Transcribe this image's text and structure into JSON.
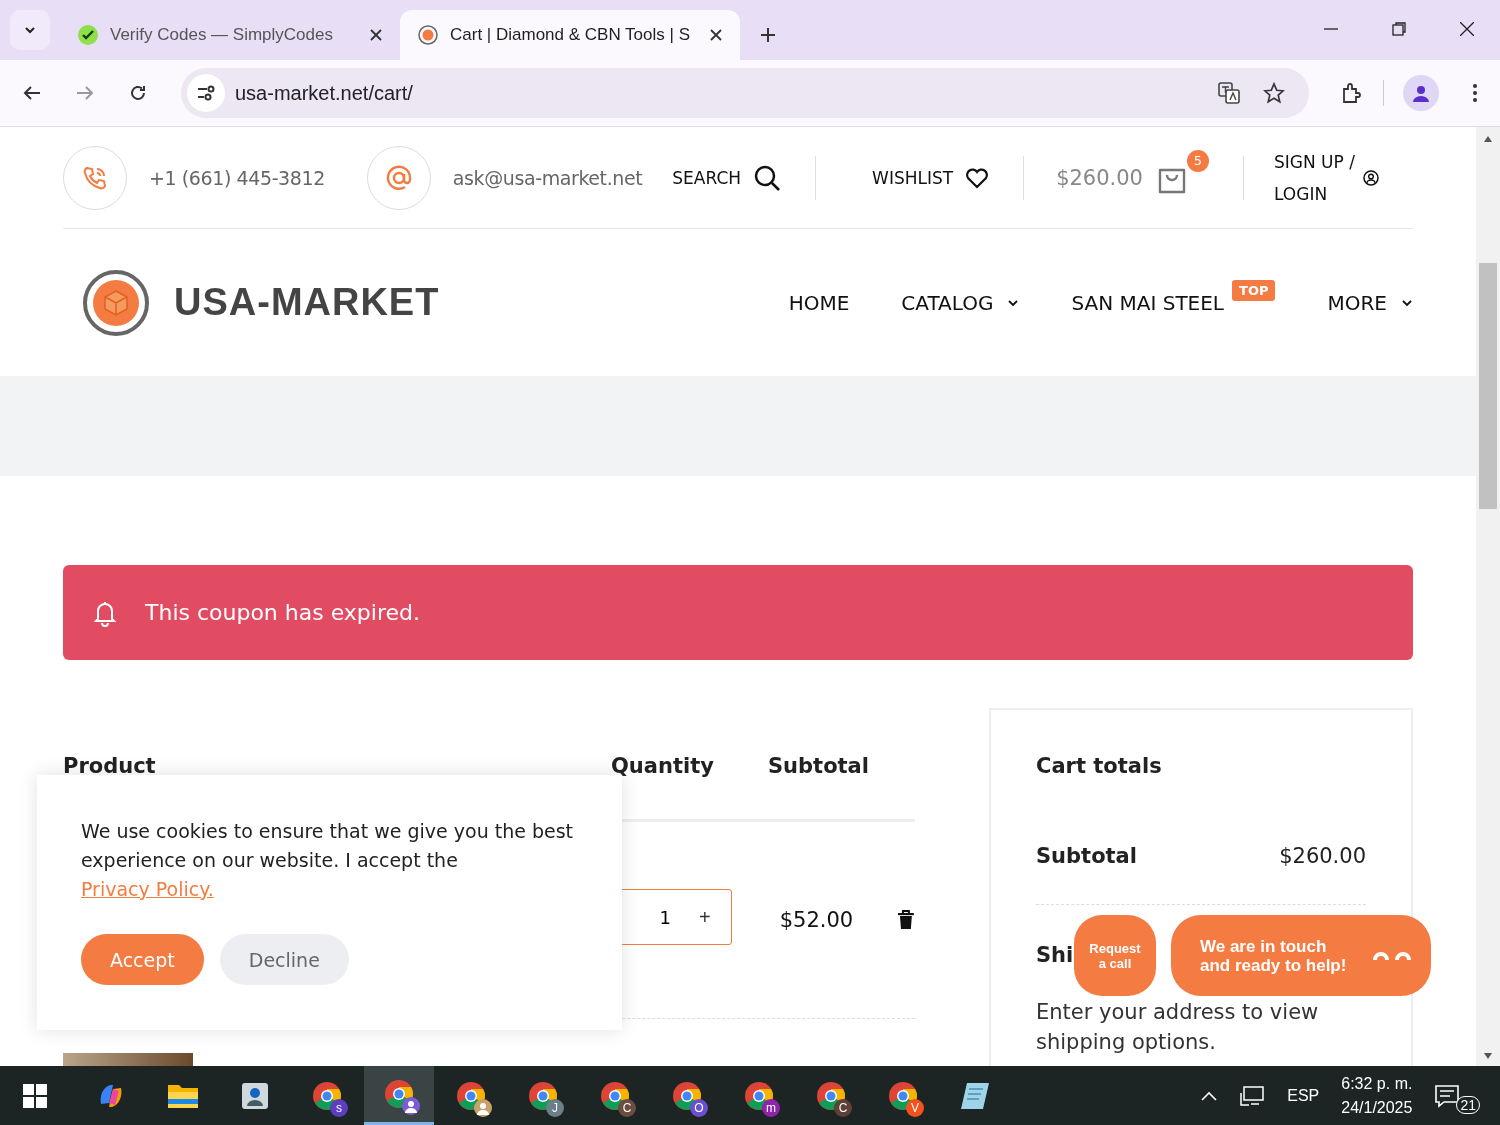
{
  "browser": {
    "tabs": [
      {
        "title": "Verify Codes — SimplyCodes",
        "selected": false
      },
      {
        "title": "Cart | Diamond & CBN Tools | S",
        "selected": true
      }
    ],
    "url": "usa-market.net/cart/"
  },
  "topbar": {
    "phone": "+1 (661) 445-3812",
    "email": "ask@usa-market.net",
    "search": "SEARCH",
    "wishlist": "WISHLIST",
    "cart_total": "$260.00",
    "cart_count": "5",
    "account": [
      "SIGN UP /",
      "LOGIN"
    ]
  },
  "header": {
    "logo": "USA-MARKET",
    "nav": [
      {
        "label": "HOME",
        "dropdown": false
      },
      {
        "label": "CATALOG",
        "dropdown": true
      },
      {
        "label": "SAN MAI STEEL",
        "dropdown": false,
        "badge": "TOP"
      },
      {
        "label": "MORE",
        "dropdown": true
      }
    ]
  },
  "notice": "This coupon has expired.",
  "cart_table": {
    "columns": [
      "Product",
      "Quantity",
      "Subtotal"
    ],
    "rows": [
      {
        "quantity": "1",
        "increment": "+",
        "subtotal": "$52.00"
      }
    ]
  },
  "cart_totals": {
    "title": "Cart totals",
    "subtotal_label": "Subtotal",
    "subtotal_value": "$260.00",
    "shipping_label": "Shi",
    "shipping_note": "Enter your address to view shipping options."
  },
  "cookie_popup": {
    "text": "We use cookies to ensure that we give you the best experience on our website. I accept the",
    "link": "Privacy Policy.",
    "buttons": [
      {
        "label": "Accept",
        "kind": "primary"
      },
      {
        "label": "Decline",
        "kind": "secondary"
      }
    ]
  },
  "chat": {
    "call_button": "Request a call",
    "message": "We are in touch and ready to help!"
  },
  "taskbar": {
    "apps": [
      {
        "kind": "copilot",
        "selected": false
      },
      {
        "kind": "folder",
        "selected": false
      },
      {
        "kind": "contacts",
        "selected": false
      },
      {
        "kind": "chrome",
        "badge": "s",
        "color": "#5b3fbf",
        "selected": false
      },
      {
        "kind": "chrome-avatar",
        "color": "#7b5bd6",
        "selected": true
      },
      {
        "kind": "chrome-avatar",
        "color": "#c8a26a",
        "selected": false
      },
      {
        "kind": "chrome",
        "badge": "J",
        "color": "#6b7f8a",
        "selected": false
      },
      {
        "kind": "chrome",
        "badge": "C",
        "color": "#6d4c41",
        "selected": false
      },
      {
        "kind": "chrome",
        "badge": "O",
        "color": "#6a4fd0",
        "selected": false
      },
      {
        "kind": "chrome",
        "badge": "m",
        "color": "#8e24aa",
        "selected": false
      },
      {
        "kind": "chrome",
        "badge": "C",
        "color": "#5d4037",
        "selected": false
      },
      {
        "kind": "chrome",
        "badge": "V",
        "color": "#f4511e",
        "selected": false
      },
      {
        "kind": "notes",
        "selected": false
      }
    ],
    "language": "ESP",
    "time": "6:32 p. m.",
    "date": "24/1/2025",
    "notifications": "21"
  }
}
